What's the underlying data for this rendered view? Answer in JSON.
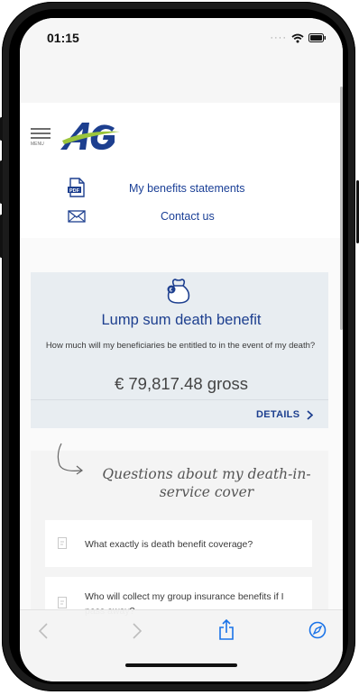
{
  "status_bar": {
    "time": "01:15"
  },
  "header": {
    "menu_label": "MENU",
    "logo_text": "AG"
  },
  "links": [
    {
      "label": "My benefits statements",
      "icon": "pdf-icon"
    },
    {
      "label": "Contact us",
      "icon": "envelope-icon"
    }
  ],
  "benefit_card": {
    "icon": "money-bag-icon",
    "title": "Lump sum death benefit",
    "question": "How much will my beneficiaries be entitled to in the event of my death?",
    "amount": "€ 79,817.48 gross",
    "details_label": "DETAILS"
  },
  "faq": {
    "heading": "Questions about my death-in-service cover",
    "items": [
      {
        "text": "What exactly is death benefit coverage?"
      },
      {
        "text": "Who will collect my group insurance benefits if I pass away?"
      }
    ]
  },
  "toolbar": {
    "icons": [
      "back-icon",
      "forward-icon",
      "share-icon",
      "compass-icon"
    ]
  },
  "colors": {
    "brand_blue": "#1d3f8f",
    "link_blue": "#1a3f96",
    "brand_green": "#9bc53c",
    "card_bg": "#e8edf1"
  }
}
